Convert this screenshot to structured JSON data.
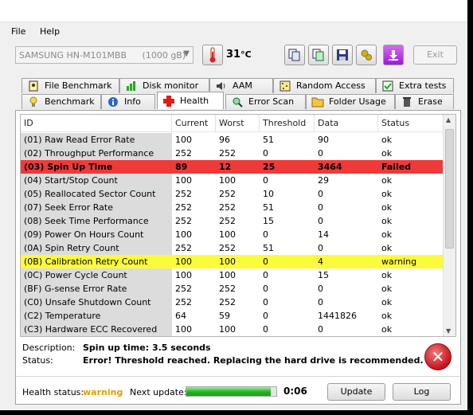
{
  "menu": {
    "file": "File",
    "help": "Help"
  },
  "toolbar": {
    "drive": "SAMSUNG HN-M101MBB",
    "drive_size": "(1000 gB)",
    "temperature": "31",
    "temperature_unit": "°C",
    "exit_label": "Exit"
  },
  "tabs_top": [
    {
      "label": "File Benchmark",
      "icon": "file-benchmark-icon"
    },
    {
      "label": "Disk monitor",
      "icon": "disk-monitor-icon"
    },
    {
      "label": "AAM",
      "icon": "speaker-icon"
    },
    {
      "label": "Random Access",
      "icon": "random-access-icon"
    },
    {
      "label": "Extra tests",
      "icon": "extra-tests-icon"
    }
  ],
  "tabs_bottom": [
    {
      "label": "Benchmark",
      "icon": "lightbulb-icon"
    },
    {
      "label": "Info",
      "icon": "info-icon"
    },
    {
      "label": "Health",
      "icon": "health-cross-icon",
      "active": true
    },
    {
      "label": "Error Scan",
      "icon": "magnifier-icon"
    },
    {
      "label": "Folder Usage",
      "icon": "folder-icon"
    },
    {
      "label": "Erase",
      "icon": "trash-icon"
    }
  ],
  "columns": [
    "ID",
    "Current",
    "Worst",
    "Threshold",
    "Data",
    "Status"
  ],
  "rows": [
    [
      "(01) Raw Read Error Rate",
      "100",
      "96",
      "51",
      "90",
      "ok"
    ],
    [
      "(02) Throughput Performance",
      "252",
      "252",
      "0",
      "0",
      "ok"
    ],
    [
      "(03) Spin Up Time",
      "89",
      "12",
      "25",
      "3464",
      "Failed"
    ],
    [
      "(04) Start/Stop Count",
      "100",
      "100",
      "0",
      "29",
      "ok"
    ],
    [
      "(05) Reallocated Sector Count",
      "252",
      "252",
      "10",
      "0",
      "ok"
    ],
    [
      "(07) Seek Error Rate",
      "252",
      "252",
      "51",
      "0",
      "ok"
    ],
    [
      "(08) Seek Time Performance",
      "252",
      "252",
      "15",
      "0",
      "ok"
    ],
    [
      "(09) Power On Hours Count",
      "100",
      "100",
      "0",
      "14",
      "ok"
    ],
    [
      "(0A) Spin Retry Count",
      "252",
      "252",
      "51",
      "0",
      "ok"
    ],
    [
      "(0B) Calibration Retry Count",
      "100",
      "100",
      "0",
      "4",
      "warning"
    ],
    [
      "(0C) Power Cycle Count",
      "100",
      "100",
      "0",
      "15",
      "ok"
    ],
    [
      "(BF) G-sense Error Rate",
      "252",
      "252",
      "0",
      "0",
      "ok"
    ],
    [
      "(C0) Unsafe Shutdown Count",
      "252",
      "252",
      "0",
      "0",
      "ok"
    ],
    [
      "(C2) Temperature",
      "64",
      "59",
      "0",
      "1441826",
      "ok"
    ],
    [
      "(C3) Hardware ECC Recovered",
      "100",
      "100",
      "0",
      "0",
      "ok"
    ]
  ],
  "description": {
    "desc_label": "Description:",
    "desc_value": "Spin up time: 3.5 seconds",
    "status_label": "Status:",
    "status_value": "Error! Threshold reached. Replacing the hard drive is recommended."
  },
  "footer": {
    "health_label": "Health status:",
    "health_value": "warning",
    "next_label": "Next update:",
    "progress_percent": 94,
    "countdown": "0:06",
    "update_label": "Update",
    "log_label": "Log"
  },
  "colors": {
    "failed": "#ef3a3a",
    "warning": "#fbfb3c",
    "warning_text": "#e0a000"
  }
}
